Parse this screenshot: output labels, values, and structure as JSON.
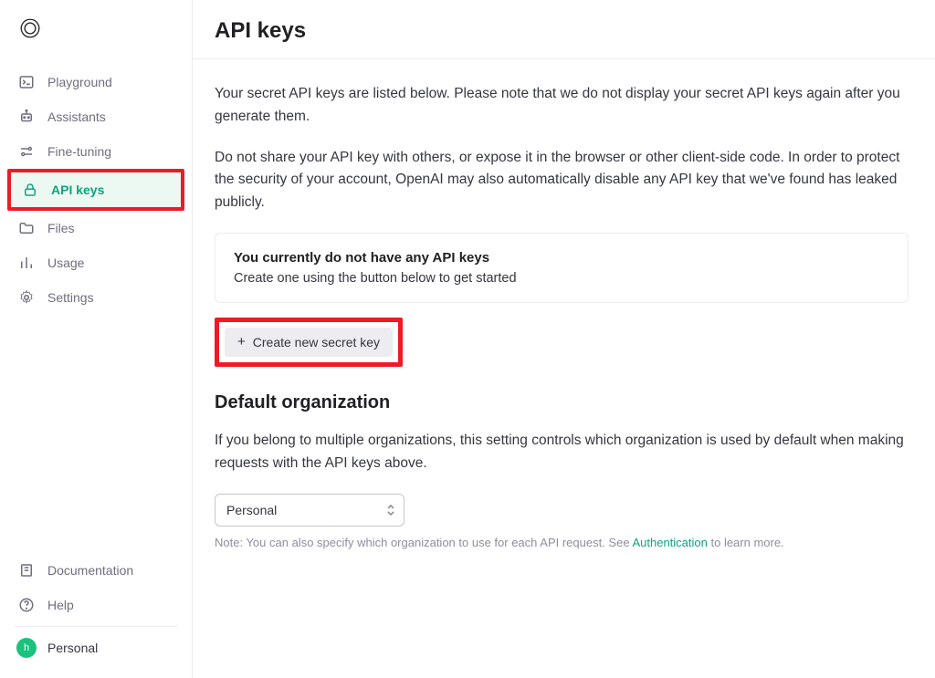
{
  "sidebar": {
    "items": [
      {
        "label": "Playground"
      },
      {
        "label": "Assistants"
      },
      {
        "label": "Fine-tuning"
      },
      {
        "label": "API keys"
      },
      {
        "label": "Files"
      },
      {
        "label": "Usage"
      },
      {
        "label": "Settings"
      }
    ],
    "bottom": [
      {
        "label": "Documentation"
      },
      {
        "label": "Help"
      }
    ],
    "account_label": "Personal",
    "avatar_initial": "h"
  },
  "page": {
    "title": "API keys",
    "para1": "Your secret API keys are listed below. Please note that we do not display your secret API keys again after you generate them.",
    "para2": "Do not share your API key with others, or expose it in the browser or other client-side code. In order to protect the security of your account, OpenAI may also automatically disable any API key that we've found has leaked publicly.",
    "empty_title": "You currently do not have any API keys",
    "empty_sub": "Create one using the button below to get started",
    "create_label": "Create new secret key",
    "org_heading": "Default organization",
    "org_para": "If you belong to multiple organizations, this setting controls which organization is used by default when making requests with the API keys above.",
    "org_selected": "Personal",
    "note_prefix": "Note: You can also specify which organization to use for each API request. See ",
    "note_link": "Authentication",
    "note_suffix": " to learn more."
  }
}
